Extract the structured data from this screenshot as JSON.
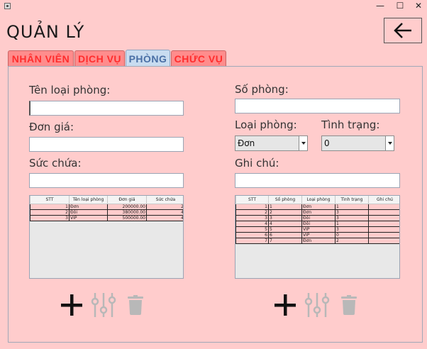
{
  "window": {
    "minimize_glyph": "—",
    "maximize_glyph": "☐",
    "close_glyph": "✕"
  },
  "header": {
    "title": "QUẢN LÝ",
    "back_icon": "arrow-left-icon"
  },
  "tabs": [
    {
      "label": "NHÂN VIÊN",
      "active": false
    },
    {
      "label": "DỊCH VỤ",
      "active": false
    },
    {
      "label": "PHÒNG",
      "active": true
    },
    {
      "label": "CHỨC VỤ",
      "active": false
    }
  ],
  "room_type_form": {
    "name_label": "Tên loại phòng:",
    "name_value": "",
    "price_label": "Đơn giá:",
    "price_value": "",
    "capacity_label": "Sức chứa:",
    "capacity_value": ""
  },
  "room_form": {
    "number_label": "Số phòng:",
    "number_value": "",
    "type_label": "Loại phòng:",
    "type_selected": "Đơn",
    "status_label": "Tình trạng:",
    "status_selected": "0",
    "note_label": "Ghi chú:",
    "note_value": ""
  },
  "room_type_table": {
    "columns": [
      "STT",
      "Tên loại phòng",
      "Đơn giá",
      "Sức chứa"
    ],
    "rows": [
      [
        "1",
        "Đơn",
        "200000.00",
        "2"
      ],
      [
        "2",
        "Đôi",
        "380000.00",
        "4"
      ],
      [
        "3",
        "VIP",
        "500000.00",
        "4"
      ]
    ]
  },
  "room_table": {
    "columns": [
      "STT",
      "Số phòng",
      "Loại phòng",
      "Tình trạng",
      "Ghi chú"
    ],
    "rows": [
      [
        "1",
        "1",
        "Đơn",
        "1",
        ""
      ],
      [
        "2",
        "2",
        "Đơn",
        "3",
        ""
      ],
      [
        "3",
        "3",
        "Đôi",
        "3",
        ""
      ],
      [
        "4",
        "4",
        "Đôi",
        "1",
        ""
      ],
      [
        "5",
        "5",
        "VIP",
        "3",
        ""
      ],
      [
        "6",
        "6",
        "VIP",
        "0",
        ""
      ],
      [
        "7",
        "7",
        "Đơn",
        "2",
        ""
      ]
    ]
  },
  "actions": {
    "add_icon": "plus-icon",
    "edit_icon": "sliders-icon",
    "delete_icon": "trash-icon",
    "enabled_color": "#111111",
    "disabled_color": "#b8b8b8"
  },
  "colors": {
    "background": "#ffcccc",
    "tab_inactive": "#ff8c8c",
    "tab_text": "#ff2d2d",
    "tab_active": "#c8dcf0"
  }
}
